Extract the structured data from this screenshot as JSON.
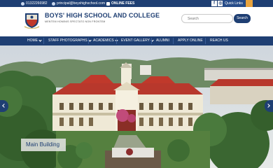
{
  "topbar": {
    "phone": "01322266982",
    "email": "principal@boyshighschool.com",
    "online_fees": "ONLINE FEES",
    "social": [
      {
        "icon": "facebook-icon",
        "glyph": "f"
      },
      {
        "icon": "instagram-icon",
        "glyph": "◎"
      },
      {
        "icon": "youtube-icon",
        "glyph": "▶"
      }
    ],
    "quick_links": "Quick Links"
  },
  "header": {
    "school_name": "BOYS' HIGH SCHOOL AND COLLEGE",
    "motto": "MENTEM HOMINIS SPECTATO NON FRONTEM",
    "search_placeholder": "Search",
    "search_button": "Search"
  },
  "nav": {
    "items": [
      {
        "label": "HOME",
        "dropdown": true
      },
      {
        "label": "STAFF PHOTOGRAPHS",
        "dropdown": true
      },
      {
        "label": "ACADEMICS",
        "dropdown": true
      },
      {
        "label": "EVENT GALLERY",
        "dropdown": true
      },
      {
        "label": "ALUMNI",
        "dropdown": false
      },
      {
        "label": "APPLY ONLINE",
        "dropdown": false
      },
      {
        "label": "REACH US",
        "dropdown": false
      }
    ]
  },
  "slider": {
    "caption": "Main Building"
  },
  "colors": {
    "primary": "#1f3f73",
    "accent": "#e8a33d",
    "roof": "#c0392b"
  }
}
